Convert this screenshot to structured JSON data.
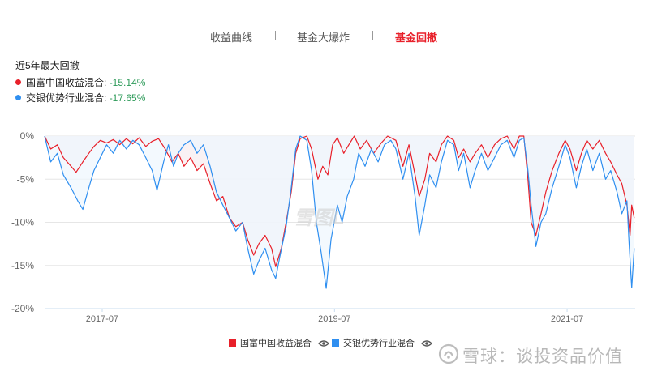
{
  "tabs": [
    {
      "label": "收益曲线",
      "active": false
    },
    {
      "label": "基金大爆炸",
      "active": false
    },
    {
      "label": "基金回撤",
      "active": true
    }
  ],
  "summary": {
    "title": "近5年最大回撤",
    "items": [
      {
        "name": "国富中国收益混合:",
        "value": "-15.14%",
        "color": "#e8202a"
      },
      {
        "name": "交银优势行业混合:",
        "value": "-17.65%",
        "color": "#2f8ff0"
      }
    ]
  },
  "watermark": {
    "center_text": "雪图L",
    "bottom_text": "雪球：谈投资品价值"
  },
  "chart_data": {
    "type": "line",
    "title": "",
    "xlabel": "",
    "ylabel": "",
    "x_range": [
      "2017-01-01",
      "2022-01-31"
    ],
    "x_ticks": [
      {
        "date": "2017-07-01",
        "label": "2017-07"
      },
      {
        "date": "2019-07-01",
        "label": "2019-07"
      },
      {
        "date": "2021-07-01",
        "label": "2021-07"
      }
    ],
    "ylim": [
      -20,
      0
    ],
    "y_ticks": [
      {
        "value": 0,
        "label": "0%"
      },
      {
        "value": -5,
        "label": "-5%"
      },
      {
        "value": -10,
        "label": "-10%"
      },
      {
        "value": -15,
        "label": "-15%"
      },
      {
        "value": -20,
        "label": "-20%"
      }
    ],
    "grid": true,
    "legend_position": "bottom",
    "series": [
      {
        "name": "国富中国收益混合",
        "color": "#e8202a",
        "fill": "#f6edf0",
        "points": [
          [
            "2017-01-01",
            0
          ],
          [
            "2017-01-20",
            -1.5
          ],
          [
            "2017-02-10",
            -1.0
          ],
          [
            "2017-03-01",
            -2.5
          ],
          [
            "2017-03-25",
            -3.5
          ],
          [
            "2017-04-10",
            -4.2
          ],
          [
            "2017-05-01",
            -3.0
          ],
          [
            "2017-05-20",
            -2.0
          ],
          [
            "2017-06-05",
            -1.2
          ],
          [
            "2017-06-25",
            -0.5
          ],
          [
            "2017-07-15",
            -0.8
          ],
          [
            "2017-08-05",
            -0.4
          ],
          [
            "2017-08-25",
            -1.0
          ],
          [
            "2017-09-15",
            -0.3
          ],
          [
            "2017-10-05",
            -0.9
          ],
          [
            "2017-10-25",
            -0.2
          ],
          [
            "2017-11-15",
            -1.2
          ],
          [
            "2017-12-05",
            -0.6
          ],
          [
            "2017-12-25",
            -0.3
          ],
          [
            "2018-01-15",
            -1.5
          ],
          [
            "2018-02-05",
            -3.0
          ],
          [
            "2018-02-25",
            -2.0
          ],
          [
            "2018-03-15",
            -3.5
          ],
          [
            "2018-04-05",
            -2.5
          ],
          [
            "2018-04-25",
            -4.0
          ],
          [
            "2018-05-15",
            -3.2
          ],
          [
            "2018-06-05",
            -5.5
          ],
          [
            "2018-06-25",
            -7.5
          ],
          [
            "2018-07-15",
            -7.0
          ],
          [
            "2018-08-05",
            -9.5
          ],
          [
            "2018-08-25",
            -10.5
          ],
          [
            "2018-09-15",
            -10.0
          ],
          [
            "2018-10-01",
            -12.0
          ],
          [
            "2018-10-20",
            -13.8
          ],
          [
            "2018-11-05",
            -12.5
          ],
          [
            "2018-11-25",
            -11.5
          ],
          [
            "2018-12-15",
            -13.0
          ],
          [
            "2018-12-28",
            -15.14
          ],
          [
            "2019-01-15",
            -13.0
          ],
          [
            "2019-01-30",
            -10.0
          ],
          [
            "2019-02-15",
            -6.5
          ],
          [
            "2019-03-01",
            -2.0
          ],
          [
            "2019-03-15",
            -0.3
          ],
          [
            "2019-04-05",
            0
          ],
          [
            "2019-04-20",
            -1.5
          ],
          [
            "2019-05-10",
            -5.0
          ],
          [
            "2019-05-25",
            -3.5
          ],
          [
            "2019-06-10",
            -4.5
          ],
          [
            "2019-06-25",
            -1.0
          ],
          [
            "2019-07-10",
            -0.2
          ],
          [
            "2019-07-30",
            -2.0
          ],
          [
            "2019-08-15",
            -1.0
          ],
          [
            "2019-09-01",
            0
          ],
          [
            "2019-09-20",
            -1.5
          ],
          [
            "2019-10-10",
            -0.5
          ],
          [
            "2019-11-01",
            -2.0
          ],
          [
            "2019-11-25",
            -0.8
          ],
          [
            "2019-12-15",
            0
          ],
          [
            "2020-01-10",
            -0.5
          ],
          [
            "2020-02-01",
            -3.5
          ],
          [
            "2020-02-20",
            -1.0
          ],
          [
            "2020-03-10",
            -4.5
          ],
          [
            "2020-03-23",
            -7.0
          ],
          [
            "2020-04-10",
            -5.0
          ],
          [
            "2020-04-25",
            -2.0
          ],
          [
            "2020-05-15",
            -3.0
          ],
          [
            "2020-06-01",
            -1.0
          ],
          [
            "2020-06-20",
            0
          ],
          [
            "2020-07-10",
            -0.5
          ],
          [
            "2020-07-25",
            -2.5
          ],
          [
            "2020-08-10",
            -1.5
          ],
          [
            "2020-08-30",
            -3.0
          ],
          [
            "2020-09-15",
            -2.0
          ],
          [
            "2020-10-05",
            -1.0
          ],
          [
            "2020-10-25",
            -2.5
          ],
          [
            "2020-11-15",
            -1.0
          ],
          [
            "2020-12-05",
            -0.3
          ],
          [
            "2020-12-25",
            0
          ],
          [
            "2021-01-15",
            -1.5
          ],
          [
            "2021-02-01",
            0
          ],
          [
            "2021-02-15",
            0
          ],
          [
            "2021-02-28",
            -5.0
          ],
          [
            "2021-03-10",
            -10.0
          ],
          [
            "2021-03-25",
            -11.5
          ],
          [
            "2021-04-10",
            -9.0
          ],
          [
            "2021-04-25",
            -6.5
          ],
          [
            "2021-05-15",
            -4.0
          ],
          [
            "2021-06-05",
            -2.0
          ],
          [
            "2021-06-25",
            -0.5
          ],
          [
            "2021-07-10",
            -1.5
          ],
          [
            "2021-07-30",
            -4.0
          ],
          [
            "2021-08-15",
            -2.0
          ],
          [
            "2021-09-01",
            -0.5
          ],
          [
            "2021-09-20",
            -1.5
          ],
          [
            "2021-10-10",
            -0.5
          ],
          [
            "2021-10-30",
            -2.0
          ],
          [
            "2021-11-15",
            -3.0
          ],
          [
            "2021-12-05",
            -4.5
          ],
          [
            "2021-12-20",
            -5.5
          ],
          [
            "2022-01-05",
            -8.0
          ],
          [
            "2022-01-15",
            -11.5
          ],
          [
            "2022-01-20",
            -8.0
          ],
          [
            "2022-01-28",
            -9.5
          ]
        ]
      },
      {
        "name": "交银优势行业混合",
        "color": "#2f8ff0",
        "fill": "#eef6fd",
        "points": [
          [
            "2017-01-01",
            0
          ],
          [
            "2017-01-20",
            -3.0
          ],
          [
            "2017-02-10",
            -2.0
          ],
          [
            "2017-03-01",
            -4.5
          ],
          [
            "2017-03-25",
            -6.0
          ],
          [
            "2017-04-15",
            -7.5
          ],
          [
            "2017-05-01",
            -8.5
          ],
          [
            "2017-05-20",
            -6.0
          ],
          [
            "2017-06-05",
            -4.0
          ],
          [
            "2017-06-25",
            -2.5
          ],
          [
            "2017-07-15",
            -1.0
          ],
          [
            "2017-08-05",
            -2.0
          ],
          [
            "2017-08-25",
            -0.5
          ],
          [
            "2017-09-15",
            -1.5
          ],
          [
            "2017-10-05",
            -0.5
          ],
          [
            "2017-10-25",
            -1.0
          ],
          [
            "2017-11-15",
            -2.5
          ],
          [
            "2017-12-05",
            -4.0
          ],
          [
            "2017-12-20",
            -6.3
          ],
          [
            "2018-01-10",
            -3.0
          ],
          [
            "2018-01-25",
            -1.0
          ],
          [
            "2018-02-10",
            -3.5
          ],
          [
            "2018-02-25",
            -2.0
          ],
          [
            "2018-03-15",
            -1.0
          ],
          [
            "2018-04-05",
            -0.5
          ],
          [
            "2018-04-25",
            -2.0
          ],
          [
            "2018-05-15",
            -1.0
          ],
          [
            "2018-06-05",
            -3.5
          ],
          [
            "2018-06-25",
            -6.5
          ],
          [
            "2018-07-15",
            -8.0
          ],
          [
            "2018-08-05",
            -9.5
          ],
          [
            "2018-08-25",
            -11.0
          ],
          [
            "2018-09-15",
            -10.0
          ],
          [
            "2018-10-01",
            -13.0
          ],
          [
            "2018-10-20",
            -16.0
          ],
          [
            "2018-11-05",
            -14.5
          ],
          [
            "2018-11-25",
            -13.0
          ],
          [
            "2018-12-15",
            -15.5
          ],
          [
            "2018-12-28",
            -16.5
          ],
          [
            "2019-01-10",
            -14.0
          ],
          [
            "2019-01-30",
            -10.5
          ],
          [
            "2019-02-15",
            -6.0
          ],
          [
            "2019-03-01",
            -1.5
          ],
          [
            "2019-03-15",
            0
          ],
          [
            "2019-04-05",
            -0.5
          ],
          [
            "2019-04-20",
            -4.0
          ],
          [
            "2019-05-05",
            -10.0
          ],
          [
            "2019-05-20",
            -13.5
          ],
          [
            "2019-06-05",
            -17.65
          ],
          [
            "2019-06-20",
            -12.0
          ],
          [
            "2019-07-10",
            -8.0
          ],
          [
            "2019-07-25",
            -10.0
          ],
          [
            "2019-08-10",
            -7.0
          ],
          [
            "2019-08-30",
            -5.0
          ],
          [
            "2019-09-15",
            -2.0
          ],
          [
            "2019-10-05",
            -3.5
          ],
          [
            "2019-10-25",
            -1.5
          ],
          [
            "2019-11-15",
            -3.0
          ],
          [
            "2019-12-05",
            -1.0
          ],
          [
            "2019-12-25",
            -0.5
          ],
          [
            "2020-01-10",
            -1.5
          ],
          [
            "2020-02-01",
            -5.0
          ],
          [
            "2020-02-20",
            -2.0
          ],
          [
            "2020-03-10",
            -7.0
          ],
          [
            "2020-03-23",
            -11.5
          ],
          [
            "2020-04-10",
            -8.0
          ],
          [
            "2020-04-25",
            -4.5
          ],
          [
            "2020-05-15",
            -6.0
          ],
          [
            "2020-06-01",
            -3.0
          ],
          [
            "2020-06-20",
            -0.5
          ],
          [
            "2020-07-10",
            -1.0
          ],
          [
            "2020-07-25",
            -4.0
          ],
          [
            "2020-08-10",
            -2.0
          ],
          [
            "2020-08-30",
            -6.0
          ],
          [
            "2020-09-15",
            -4.0
          ],
          [
            "2020-10-05",
            -2.0
          ],
          [
            "2020-10-25",
            -4.0
          ],
          [
            "2020-11-15",
            -2.5
          ],
          [
            "2020-12-05",
            -1.0
          ],
          [
            "2020-12-25",
            -0.5
          ],
          [
            "2021-01-15",
            -2.5
          ],
          [
            "2021-02-01",
            -0.5
          ],
          [
            "2021-02-15",
            -0.2
          ],
          [
            "2021-02-28",
            -4.0
          ],
          [
            "2021-03-10",
            -8.0
          ],
          [
            "2021-03-25",
            -12.8
          ],
          [
            "2021-04-10",
            -10.0
          ],
          [
            "2021-04-25",
            -9.0
          ],
          [
            "2021-05-15",
            -6.0
          ],
          [
            "2021-06-05",
            -3.5
          ],
          [
            "2021-06-25",
            -1.0
          ],
          [
            "2021-07-10",
            -2.5
          ],
          [
            "2021-07-30",
            -6.0
          ],
          [
            "2021-08-15",
            -3.5
          ],
          [
            "2021-09-01",
            -1.5
          ],
          [
            "2021-09-20",
            -4.0
          ],
          [
            "2021-10-10",
            -2.0
          ],
          [
            "2021-10-30",
            -5.0
          ],
          [
            "2021-11-15",
            -4.0
          ],
          [
            "2021-12-05",
            -6.5
          ],
          [
            "2021-12-20",
            -9.0
          ],
          [
            "2022-01-05",
            -7.5
          ],
          [
            "2022-01-12",
            -12.5
          ],
          [
            "2022-01-20",
            -17.6
          ],
          [
            "2022-01-28",
            -13.0
          ]
        ]
      }
    ]
  }
}
